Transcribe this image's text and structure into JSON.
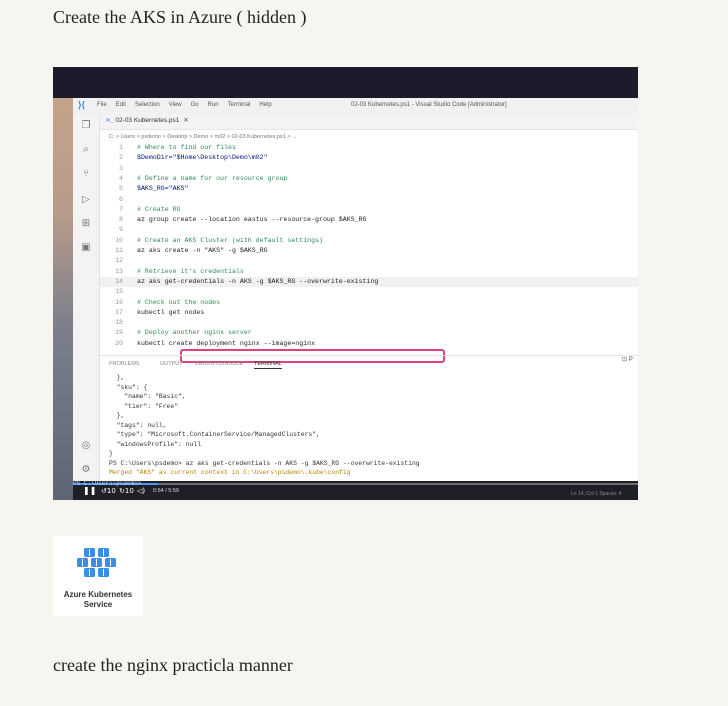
{
  "heading_top": "Create the AKS in Azure ( hidden )",
  "heading_bottom": "create the nginx practicla manner",
  "vscode": {
    "menu": [
      "File",
      "Edit",
      "Selection",
      "View",
      "Go",
      "Run",
      "Terminal",
      "Help"
    ],
    "window_title": "02-03 Kubernetes.ps1 - Visual Studio Code [Administrator]",
    "tab_label": "02-03 Kubernetes.ps1",
    "breadcrumb": "C: > Users > psdemo > Desktop > Demo > m02 > 02-03 Kubernetes.ps1 > ...",
    "code_lines": [
      {
        "n": "1",
        "t": "# Where to find our files",
        "k": "comment"
      },
      {
        "n": "2",
        "t": "$DemoDir=\"$Home\\Desktop\\Demo\\m02\"",
        "k": "var"
      },
      {
        "n": "3",
        "t": "",
        "k": ""
      },
      {
        "n": "4",
        "t": "# Define a name for our resource group",
        "k": "comment"
      },
      {
        "n": "5",
        "t": "$AKS_RG=\"AKS\"",
        "k": "var"
      },
      {
        "n": "6",
        "t": "",
        "k": ""
      },
      {
        "n": "7",
        "t": "# Create RG",
        "k": "comment"
      },
      {
        "n": "8",
        "t": "az group create --location eastus --resource-group $AKS_RG",
        "k": ""
      },
      {
        "n": "9",
        "t": "",
        "k": ""
      },
      {
        "n": "10",
        "t": "# Create an AKS Cluster (with default settings)",
        "k": "comment"
      },
      {
        "n": "11",
        "t": "az aks create -n \"AKS\" -g $AKS_RG",
        "k": ""
      },
      {
        "n": "12",
        "t": "",
        "k": ""
      },
      {
        "n": "13",
        "t": "# Retrieve it's credentials",
        "k": "comment"
      },
      {
        "n": "14",
        "t": "az aks get-credentials -n AKS -g $AKS_RG --overwrite-existing",
        "k": "current"
      },
      {
        "n": "15",
        "t": "",
        "k": ""
      },
      {
        "n": "16",
        "t": "# Check out the nodes",
        "k": "comment"
      },
      {
        "n": "17",
        "t": "kubectl get nodes",
        "k": ""
      },
      {
        "n": "18",
        "t": "",
        "k": ""
      },
      {
        "n": "19",
        "t": "# Deploy another nginx server",
        "k": "comment"
      },
      {
        "n": "20",
        "t": "kubectl create deployment nginx --image=nginx",
        "k": ""
      }
    ],
    "panel_tabs": [
      "PROBLEMS",
      "OUTPUT",
      "DEBUG CONSOLE",
      "TERMINAL"
    ],
    "panel_active": "TERMINAL",
    "panel_right": "P",
    "terminal_lines": [
      {
        "t": "  },",
        "k": ""
      },
      {
        "t": "  \"sku\": {",
        "k": ""
      },
      {
        "t": "    \"name\": \"Basic\",",
        "k": ""
      },
      {
        "t": "    \"tier\": \"Free\"",
        "k": ""
      },
      {
        "t": "  },",
        "k": ""
      },
      {
        "t": "  \"tags\": null,",
        "k": ""
      },
      {
        "t": "  \"type\": \"Microsoft.ContainerService/ManagedClusters\",",
        "k": ""
      },
      {
        "t": "  \"windowsProfile\": null",
        "k": ""
      },
      {
        "t": "}",
        "k": ""
      },
      {
        "t": "PS C:\\Users\\psdemo> az aks get-credentials -n AKS -g $AKS_RG --overwrite-existing",
        "k": ""
      },
      {
        "t": "Merged \"AKS\" as current context in C:\\Users\\psdemo\\.kube\\config",
        "k": "warn"
      }
    ],
    "ps_prompt": "PS C:\\Users\\psdemo>",
    "status_right": "Ln 14, Col 1    Spaces: 4"
  },
  "player": {
    "time": "0:54 / 5:59",
    "progress": 0.15,
    "skip_back": "10",
    "skip_fwd": "10"
  },
  "aks_logo": {
    "label_line1": "Azure Kubernetes",
    "label_line2": "Service",
    "color": "#3a8ee6"
  }
}
